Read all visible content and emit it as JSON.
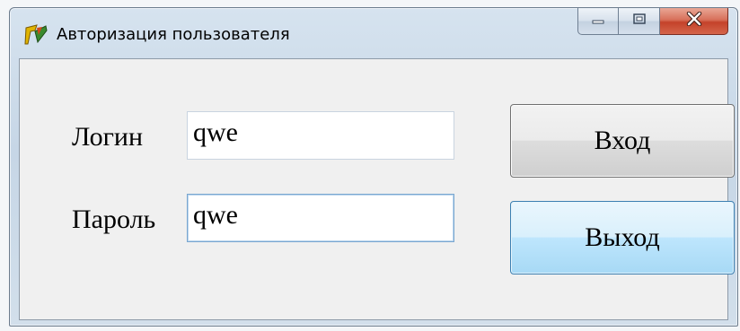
{
  "window": {
    "title": "Авторизация пользователя",
    "icon": "app-icon"
  },
  "caption": {
    "minimize_icon": "minimize-icon",
    "maximize_icon": "maximize-icon",
    "close_icon": "close-icon",
    "close_color": "#c4422a"
  },
  "form": {
    "login_label": "Логин",
    "login_value": "qwe",
    "password_label": "Пароль",
    "password_value": "qwe"
  },
  "buttons": {
    "enter_label": "Вход",
    "exit_label": "Выход"
  }
}
